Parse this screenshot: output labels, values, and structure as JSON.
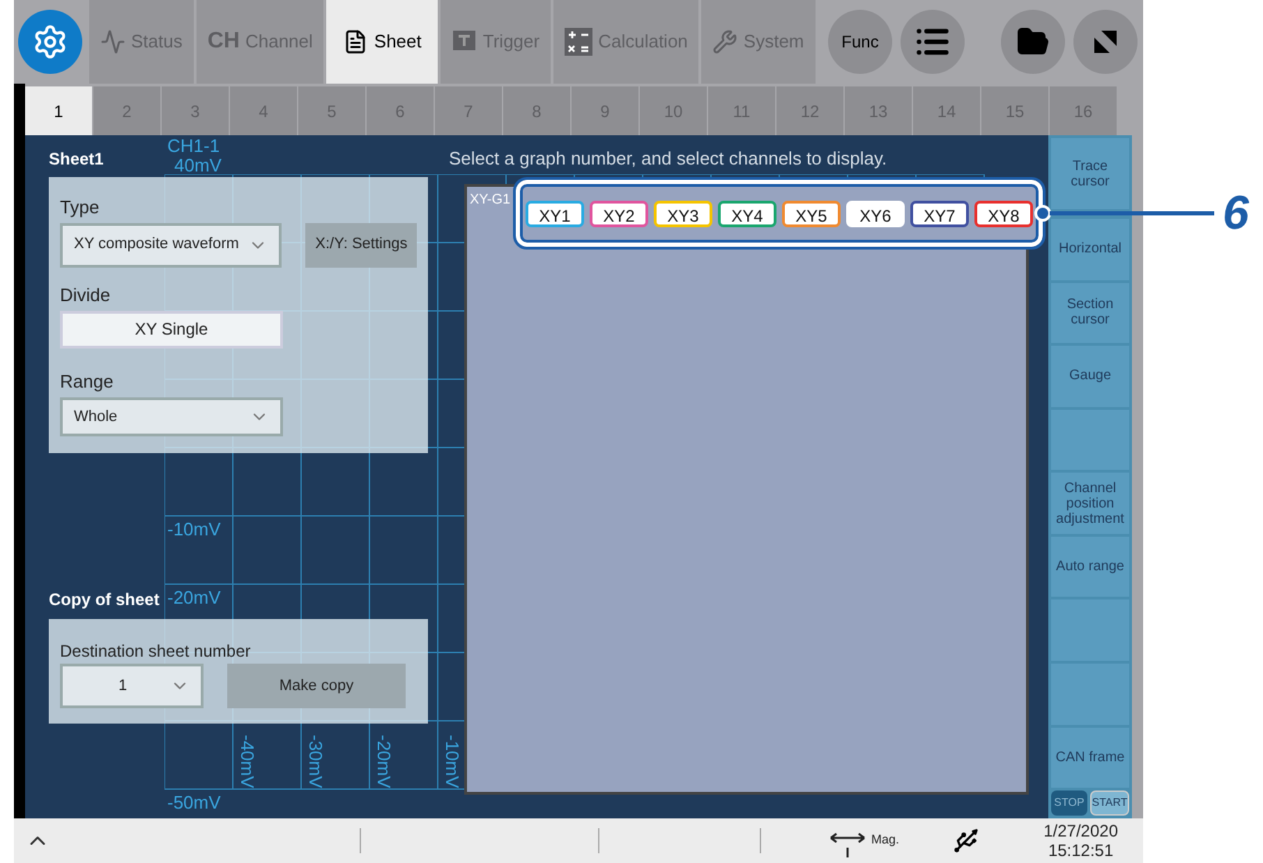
{
  "top_tabs": [
    {
      "label": "Status",
      "kind": "wave",
      "selected": false
    },
    {
      "label": "Channel",
      "kind": "ch",
      "icon_text": "CH",
      "selected": false
    },
    {
      "label": "Sheet",
      "kind": "sheet",
      "selected": true
    },
    {
      "label": "Trigger",
      "kind": "trigger",
      "selected": false
    },
    {
      "label": "Calculation",
      "kind": "calc",
      "selected": false
    },
    {
      "label": "System",
      "kind": "wrench",
      "selected": false
    }
  ],
  "func_button": "Func",
  "sheet_tabs": [
    {
      "label": "1",
      "selected": true
    },
    {
      "label": "2",
      "selected": false
    },
    {
      "label": "3",
      "selected": false
    },
    {
      "label": "4",
      "selected": false
    },
    {
      "label": "5",
      "selected": false
    },
    {
      "label": "6",
      "selected": false
    },
    {
      "label": "7",
      "selected": false
    },
    {
      "label": "8",
      "selected": false
    },
    {
      "label": "9",
      "selected": false
    },
    {
      "label": "10",
      "selected": false
    },
    {
      "label": "11",
      "selected": false
    },
    {
      "label": "12",
      "selected": false
    },
    {
      "label": "13",
      "selected": false
    },
    {
      "label": "14",
      "selected": false
    },
    {
      "label": "15",
      "selected": false
    },
    {
      "label": "16",
      "selected": false
    }
  ],
  "graph": {
    "channel": "CH1-1",
    "y_labels": [
      "40mV",
      "-10mV",
      "-20mV",
      "-50mV"
    ],
    "x_labels": [
      "-40mV",
      "-30mV",
      "-20mV",
      "-10mV"
    ]
  },
  "sheet_panel": {
    "title": "Sheet1",
    "type_label": "Type",
    "type_value": "XY composite waveform",
    "settings_button": "X:/Y: Settings",
    "divide_label": "Divide",
    "divide_value": "XY Single",
    "range_label": "Range",
    "range_value": "Whole"
  },
  "copy_panel": {
    "title": "Copy of sheet",
    "destination_label": "Destination sheet number",
    "destination_value": "1",
    "copy_button": "Make copy"
  },
  "message": "Select a graph number, and select channels to display.",
  "dialog": {
    "title": "XY-G1",
    "xy_buttons": [
      {
        "label": "XY1",
        "color": "#29abe2"
      },
      {
        "label": "XY2",
        "color": "#e0559e"
      },
      {
        "label": "XY3",
        "color": "#f5c400"
      },
      {
        "label": "XY4",
        "color": "#1aa66e"
      },
      {
        "label": "XY5",
        "color": "#f08a30"
      },
      {
        "label": "XY6",
        "color": "#ffffff"
      },
      {
        "label": "XY7",
        "color": "#4050a0"
      },
      {
        "label": "XY8",
        "color": "#e8302e"
      }
    ]
  },
  "callout": "6",
  "side_buttons": [
    {
      "kind": "text",
      "label": "Trace cursor"
    },
    {
      "kind": "text",
      "label": "Horizontal"
    },
    {
      "kind": "text",
      "label": "Section cursor"
    },
    {
      "kind": "text",
      "label": "Gauge"
    },
    {
      "kind": "blank"
    },
    {
      "kind": "text",
      "label": "Channel position adjustment"
    },
    {
      "kind": "text",
      "label": "Auto range"
    },
    {
      "kind": "blank"
    },
    {
      "kind": "blank"
    },
    {
      "kind": "text",
      "label": "CAN frame"
    }
  ],
  "run_buttons": [
    "STOP",
    "START"
  ],
  "status_bar": {
    "mag_label": "Mag.",
    "date": "1/27/2020",
    "time": "15:12:51"
  }
}
